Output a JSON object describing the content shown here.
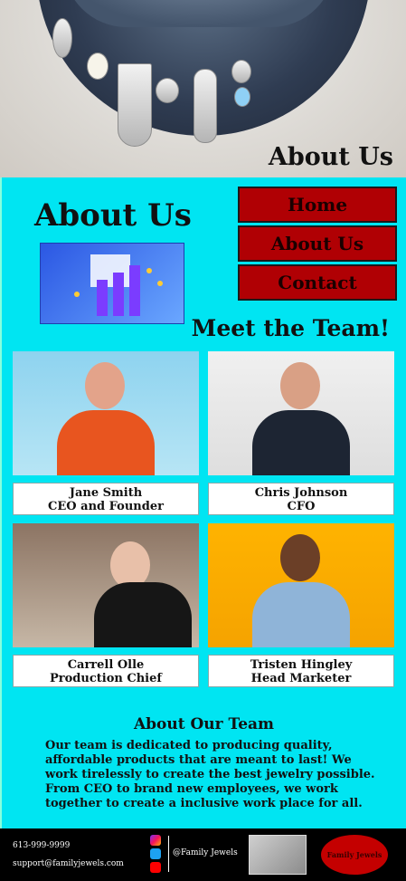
{
  "hero": {
    "title": "About Us"
  },
  "main": {
    "page_title": "About Us",
    "nav": [
      {
        "label": "Home"
      },
      {
        "label": "About Us"
      },
      {
        "label": "Contact"
      }
    ],
    "meet_heading": "Meet the Team!",
    "team": [
      {
        "name": "Jane Smith",
        "role": "CEO and Founder"
      },
      {
        "name": "Chris Johnson",
        "role": "CFO"
      },
      {
        "name": "Carrell Olle",
        "role": "Production Chief"
      },
      {
        "name": "Tristen Hingley",
        "role": "Head Marketer"
      }
    ],
    "about_heading": "About Our Team",
    "about_text": "Our team is dedicated to producing quality, affordable products that are meant to last! We work tirelessly to create the best jewelry possible. From CEO to brand new employees, we work together to create a inclusive work place for all."
  },
  "footer": {
    "phone": "613-999-9999",
    "email": "support@familyjewels.com",
    "handle": "@Family Jewels",
    "logo_text": "Family Jewels",
    "social_icons": [
      "instagram-icon",
      "twitter-icon",
      "youtube-icon"
    ]
  },
  "colors": {
    "background": "#00e5f2",
    "nav_button": "#b00004",
    "footer": "#000000"
  }
}
